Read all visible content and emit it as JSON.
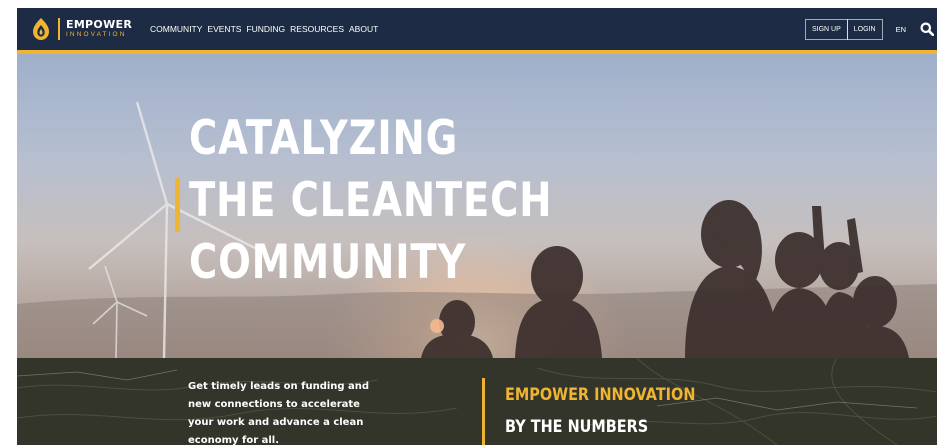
{
  "nav": {
    "logo": {
      "name": "EMPOWER",
      "sub": "INNOVATION",
      "icon": "empower-flame-logo"
    },
    "menu": [
      "COMMUNITY",
      "EVENTS",
      "FUNDING",
      "RESOURCES",
      "ABOUT"
    ],
    "signup_label": "SIGN UP",
    "login_label": "LOGIN",
    "language": "EN",
    "search_icon": "search-icon"
  },
  "hero": {
    "headline": [
      "CATALYZING",
      "THE CLEANTECH",
      "COMMUNITY"
    ]
  },
  "intro": {
    "text": "Get timely leads on funding and new connections to accelerate your work and advance a clean economy for all."
  },
  "numbers": {
    "title": "EMPOWER INNOVATION",
    "subtitle": "BY THE NUMBERS"
  },
  "colors": {
    "nav_bg": "#1d2c44",
    "accent": "#f0b433",
    "band_bg": "#33342a"
  }
}
